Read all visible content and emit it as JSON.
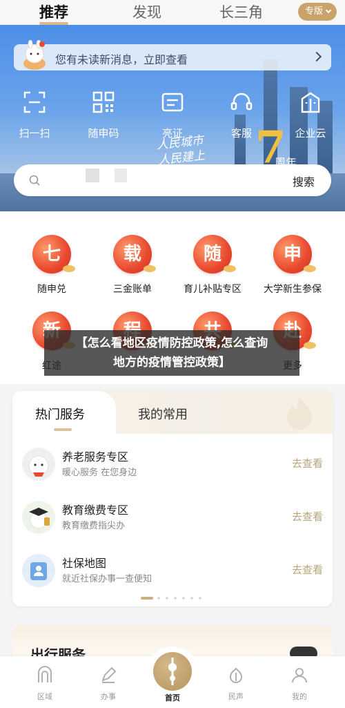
{
  "top_tabs": [
    {
      "label": "推荐",
      "active": true
    },
    {
      "label": "发现",
      "active": false
    },
    {
      "label": "长三角",
      "active": false
    }
  ],
  "version_button": {
    "label": "专版"
  },
  "notice": {
    "text": "您有未读新消息，立即查看",
    "icon": "mascot-icon"
  },
  "quick_actions": [
    {
      "label": "扫一扫",
      "icon": "scan-icon"
    },
    {
      "label": "随申码",
      "icon": "qrcode-icon"
    },
    {
      "label": "亮证",
      "icon": "card-icon"
    },
    {
      "label": "客服",
      "icon": "headset-icon"
    },
    {
      "label": "企业云",
      "icon": "building-icon"
    }
  ],
  "hero": {
    "slogan_line1": "人民城市",
    "slogan_line2": "人民建上",
    "number": "7",
    "suffix": "周年"
  },
  "search": {
    "button": "搜索",
    "icon": "search-icon"
  },
  "services": [
    {
      "glyph": "七",
      "label": "随申兑"
    },
    {
      "glyph": "载",
      "label": "三金账单"
    },
    {
      "glyph": "随",
      "label": "育儿补贴专区"
    },
    {
      "glyph": "申",
      "label": "大学新生参保"
    },
    {
      "glyph": "新",
      "label": "红途"
    },
    {
      "glyph": "程",
      "label": ""
    },
    {
      "glyph": "共",
      "label": ""
    },
    {
      "glyph": "赴",
      "label": "更多"
    }
  ],
  "overlay": {
    "line1": "【怎么看地区疫情防控政策,怎么查询",
    "line2": "地方的疫情管控政策】"
  },
  "hot_card": {
    "tabs": [
      {
        "label": "热门服务",
        "active": true
      },
      {
        "label": "我的常用",
        "active": false
      }
    ],
    "items": [
      {
        "title": "养老服务专区",
        "subtitle": "暖心服务 在您身边",
        "action": "去查看",
        "icon": "elderly-mascot-icon"
      },
      {
        "title": "教育缴费专区",
        "subtitle": "教育缴费指尖办",
        "action": "去查看",
        "icon": "graduation-icon"
      },
      {
        "title": "社保地图",
        "subtitle": "就近社保办事一查便知",
        "action": "去查看",
        "icon": "map-person-icon"
      }
    ],
    "dots_active_index": 0,
    "dots_count": 7
  },
  "travel": {
    "title": "出行服务"
  },
  "bottom_nav": [
    {
      "label": "区域",
      "icon": "region-icon"
    },
    {
      "label": "办事",
      "icon": "pen-icon"
    },
    {
      "label": "首页",
      "icon": "home-tower-icon",
      "active": true
    },
    {
      "label": "民声",
      "icon": "voice-icon"
    },
    {
      "label": "我的",
      "icon": "user-icon"
    }
  ]
}
